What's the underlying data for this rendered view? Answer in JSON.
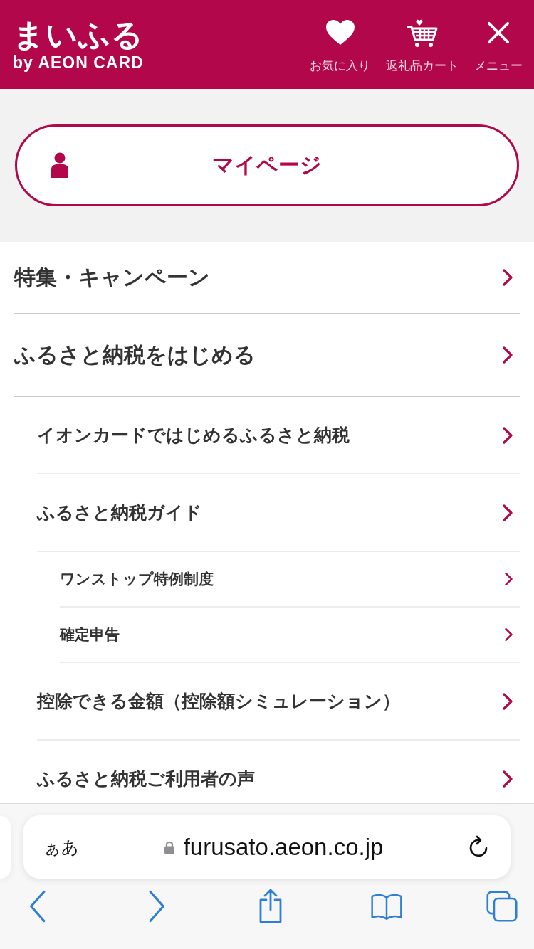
{
  "header": {
    "logo": "まいふる",
    "logo_sub": "by AEON CARD",
    "nav": [
      {
        "kind": "heart",
        "label": "お気に入り"
      },
      {
        "kind": "cart",
        "label": "返礼品カート"
      },
      {
        "kind": "close",
        "label": "メニュー"
      }
    ]
  },
  "mypage_button": {
    "label": "マイページ"
  },
  "menu": [
    {
      "label": "特集・キャンペーン"
    },
    {
      "label": "ふるさと納税をはじめる",
      "children": [
        {
          "label": "イオンカードではじめるふるさと納税"
        },
        {
          "label": "ふるさと納税ガイド",
          "children": [
            {
              "label": "ワンストップ特例制度"
            },
            {
              "label": "確定申告"
            }
          ]
        },
        {
          "label": "控除できる金額（控除額シミュレーション）"
        },
        {
          "label": "ふるさと納税ご利用者の声"
        }
      ]
    }
  ],
  "browser": {
    "text_size_button": "ぁあ",
    "url": "furusato.aeon.co.jp"
  }
}
